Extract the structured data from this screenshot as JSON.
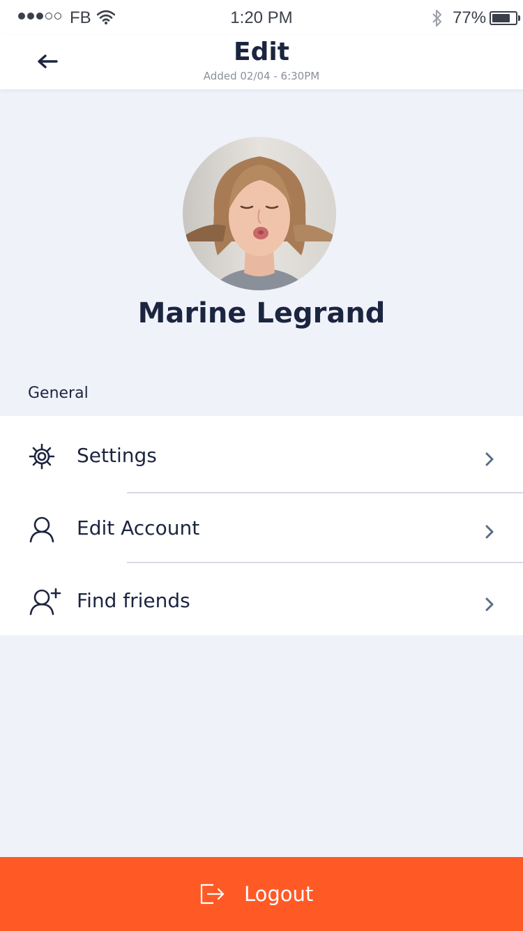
{
  "status_bar": {
    "carrier": "FB",
    "time": "1:20 PM",
    "battery_percent": "77%",
    "battery_level": 0.77,
    "signal_bars_filled": 3,
    "signal_bars_total": 5
  },
  "header": {
    "title": "Edit",
    "subtitle": "Added 02/04 - 6:30PM",
    "back_icon": "arrow-left-icon"
  },
  "profile": {
    "name": "Marine Legrand"
  },
  "section": {
    "label": "General"
  },
  "menu": {
    "items": [
      {
        "label": "Settings",
        "icon": "gear-icon"
      },
      {
        "label": "Edit Account",
        "icon": "user-icon"
      },
      {
        "label": "Find friends",
        "icon": "user-plus-icon"
      }
    ]
  },
  "logout": {
    "label": "Logout",
    "icon": "logout-icon"
  },
  "colors": {
    "accent": "#ff5a26",
    "background": "#f0f2fa",
    "text_dark": "#1c2540",
    "chevron": "#5b6b86"
  }
}
